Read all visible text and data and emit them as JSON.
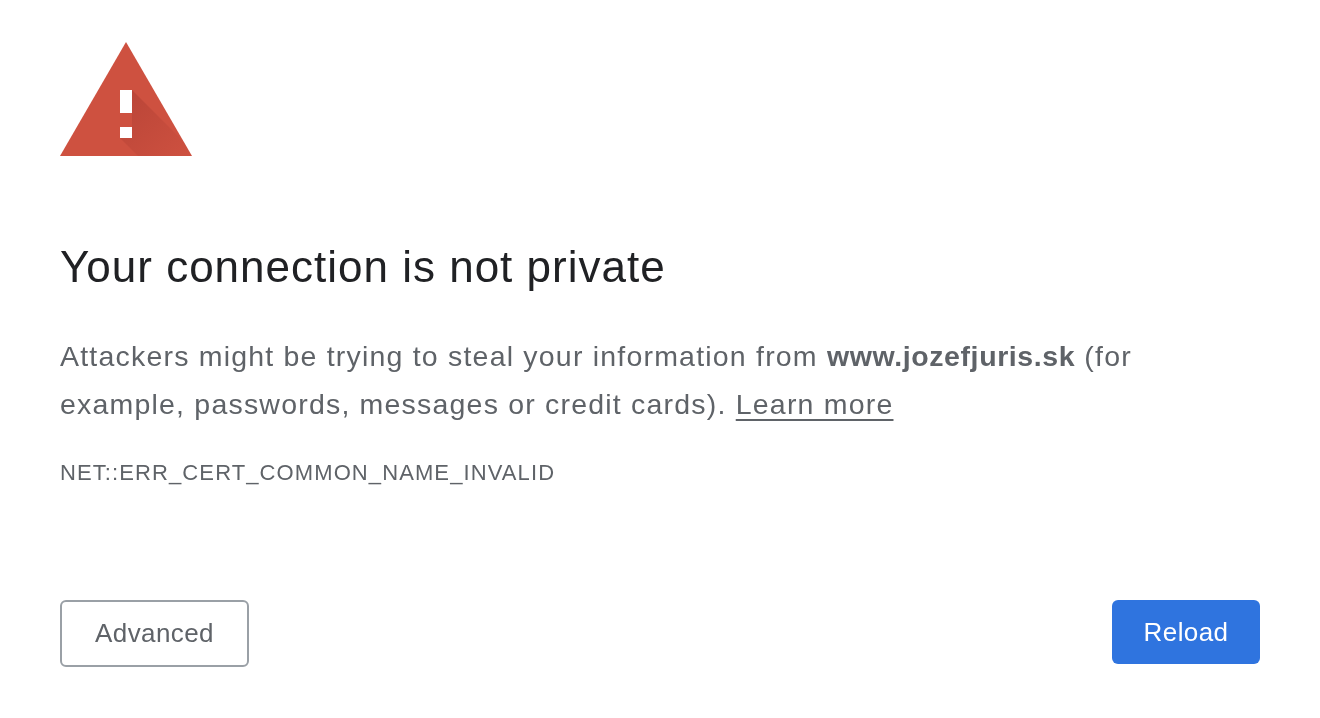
{
  "warning": {
    "heading": "Your connection is not private",
    "message": "Attackers might be trying to steal your information from **www.jozefjuris.sk** (for example, passwords, messages or credit cards).",
    "learn_more_link": "Learn more",
    "error_code": "NET::ERR_CERT_COMMON_NAME_INVALID"
  },
  "buttons": [
    {
      "label": "Advanced",
      "kind": "secondary"
    },
    {
      "label": "Reload",
      "kind": "primary"
    }
  ]
}
